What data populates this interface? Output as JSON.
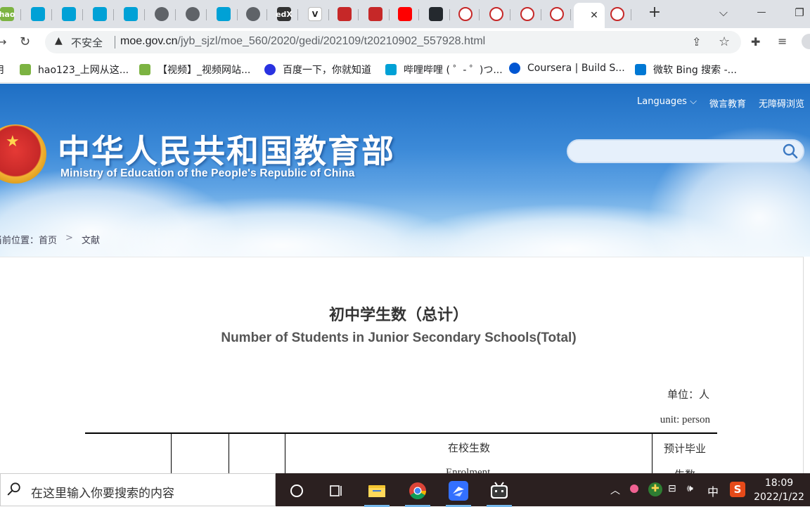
{
  "tabs": [
    {
      "icon": "hao123-icon",
      "label": "hao",
      "color": "#7cb342"
    },
    {
      "icon": "bilibili-icon",
      "color": "#00a1d6"
    },
    {
      "icon": "bilibili-icon",
      "color": "#00a1d6"
    },
    {
      "icon": "bilibili-icon",
      "color": "#00a1d6"
    },
    {
      "icon": "bilibili-icon",
      "color": "#00a1d6"
    },
    {
      "icon": "globe-icon",
      "color": "#5f6368"
    },
    {
      "icon": "globe-icon",
      "color": "#5f6368"
    },
    {
      "icon": "bilibili-icon",
      "color": "#00a1d6"
    },
    {
      "icon": "globe-icon",
      "color": "#5f6368"
    },
    {
      "icon": "edx-icon",
      "label": "edX",
      "color": "#333333"
    },
    {
      "icon": "v-icon",
      "label": "V",
      "color": "#222222"
    },
    {
      "icon": "xmind-icon",
      "color": "#c62828"
    },
    {
      "icon": "xmind-icon",
      "color": "#c62828"
    },
    {
      "icon": "youtube-icon",
      "color": "#ff0000"
    },
    {
      "icon": "github-icon",
      "color": "#24292e"
    },
    {
      "icon": "moe-icon",
      "color": "#c62828"
    },
    {
      "icon": "moe-icon",
      "color": "#c62828"
    },
    {
      "icon": "moe-icon",
      "color": "#c62828"
    },
    {
      "icon": "moe-icon",
      "color": "#c62828"
    },
    {
      "icon": "moe-icon",
      "color": "#c62828"
    }
  ],
  "address": {
    "insecure": "不安全",
    "domain": "moe.gov.cn",
    "path": "/jyb_sjzl/moe_560/2020/gedi/202109/t20210902_557928.html"
  },
  "bookmarks": [
    {
      "label": "用",
      "icon": "apps-icon"
    },
    {
      "label": "hao123_上网从这...",
      "icon": "hao123-icon"
    },
    {
      "label": "【视频】_视频网站...",
      "icon": "hao123-icon"
    },
    {
      "label": "百度一下，你就知道",
      "icon": "baidu-icon"
    },
    {
      "label": "哔哩哔哩 ( ゜- ゜)つ...",
      "icon": "bilibili-icon"
    },
    {
      "label": "Coursera | Build S...",
      "icon": "coursera-icon"
    },
    {
      "label": "微软 Bing 搜索 -...",
      "icon": "bing-icon"
    }
  ],
  "header": {
    "languages": "Languages",
    "weiyan": "微言教育",
    "accessible": "无障碍浏览",
    "title_cn": "中华人民共和国教育部",
    "title_en": "Ministry of Education of the People's Republic of China"
  },
  "breadcrumb": {
    "prefix": "当前位置：",
    "home": "首页",
    "separator": ">",
    "current": "文献"
  },
  "content": {
    "title_cn": "初中学生数（总计）",
    "title_en": "Number of Students in Junior Secondary Schools(Total)",
    "unit_cn": "单位：人",
    "unit_en": "unit: person",
    "col_enrolment_cn": "在校生数",
    "col_enrolment_en": "Enrolment",
    "col_graduates_cn": "预计毕业",
    "col_graduates_cn2": "生数"
  },
  "taskbar": {
    "search_placeholder": "在这里输入你要搜索的内容",
    "ime": "中",
    "time": "18:09",
    "date": "2022/1/22"
  }
}
